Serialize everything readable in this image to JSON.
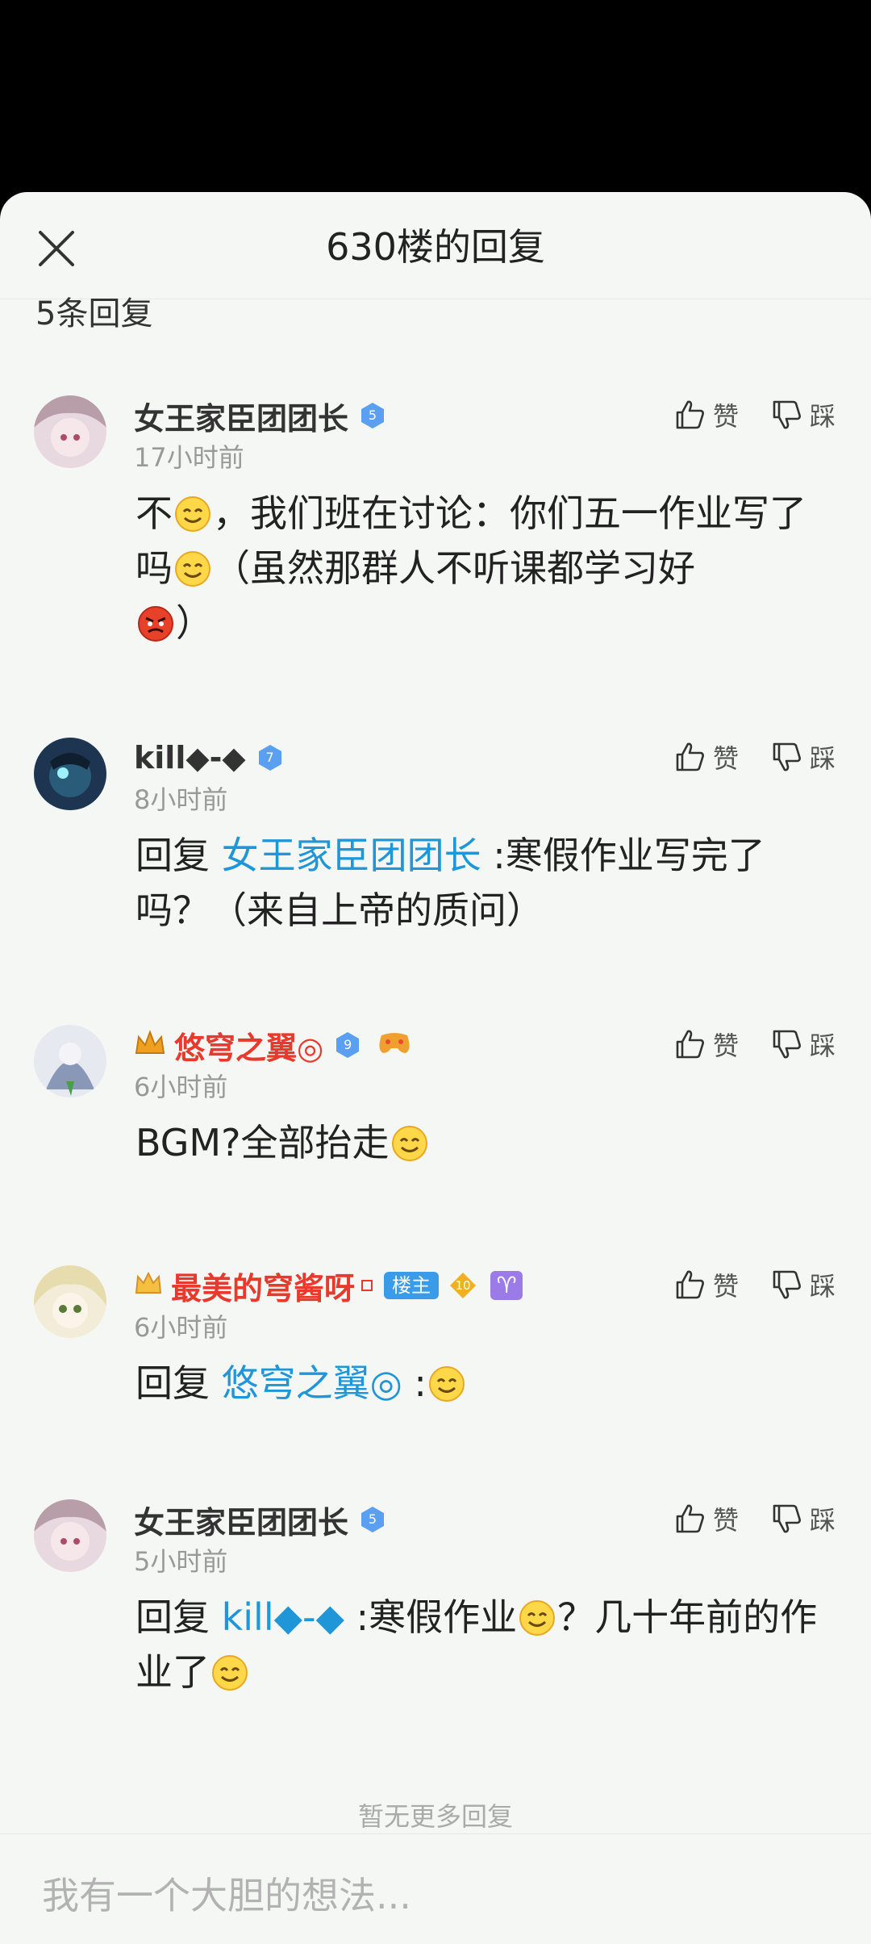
{
  "header": {
    "title": "630楼的回复"
  },
  "reply_count": "5条回复",
  "actions": {
    "like_label": "赞",
    "dislike_label": "踩"
  },
  "replies": [
    {
      "username": "女王家臣团团长",
      "level": "5",
      "time": "17小时前",
      "text_parts": [
        "不",
        "，我们班在讨论：你们五一作业写了吗",
        "（虽然那群人不听课都学习好",
        "）"
      ]
    },
    {
      "username": "kill◆-◆",
      "level": "7",
      "time": "8小时前",
      "reply_prefix": "回复",
      "reply_to": "女王家臣团团长",
      "text": " :寒假作业写完了吗？（来自上帝的质问）"
    },
    {
      "username": "悠穹之翼◎",
      "level": "9",
      "time": "6小时前",
      "text": "BGM?全部抬走"
    },
    {
      "username": "最美的穹酱呀",
      "level": "10",
      "host_badge": "楼主",
      "zodiac": "♈",
      "time": "6小时前",
      "reply_prefix": "回复",
      "reply_to": "悠穹之翼◎",
      "text": " :"
    },
    {
      "username": "女王家臣团团长",
      "level": "5",
      "time": "5小时前",
      "reply_prefix": "回复",
      "reply_to": "kill◆-◆",
      "text_parts": [
        " :寒假作业",
        "？几十年前的作业了"
      ]
    }
  ],
  "footer": {
    "no_more": "暂无更多回复"
  },
  "input": {
    "placeholder": "我有一个大胆的想法..."
  },
  "colors": {
    "link": "#1e96d8",
    "vip_name": "#e8392d",
    "level_badge": "#5a9ff0",
    "background": "#f5f7f5"
  }
}
